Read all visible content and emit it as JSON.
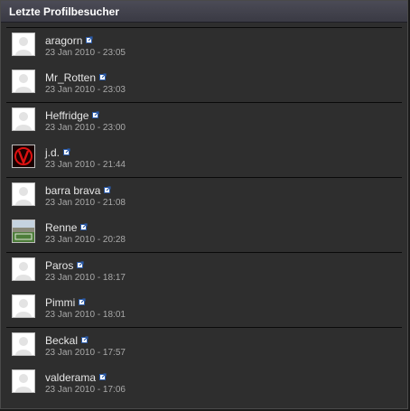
{
  "panel": {
    "title": "Letzte Profilbesucher"
  },
  "visitors": [
    {
      "name": "aragorn",
      "time": "23 Jan 2010 - 23:05",
      "avatar": "default-avatar"
    },
    {
      "name": "Mr_Rotten",
      "time": "23 Jan 2010 - 23:03",
      "avatar": "default-avatar"
    },
    {
      "name": "Heffridge",
      "time": "23 Jan 2010 - 23:00",
      "avatar": "default-avatar"
    },
    {
      "name": "j.d.",
      "time": "23 Jan 2010 - 21:44",
      "avatar": "red-v-logo"
    },
    {
      "name": "barra brava",
      "time": "23 Jan 2010 - 21:08",
      "avatar": "default-avatar"
    },
    {
      "name": "Renne",
      "time": "23 Jan 2010 - 20:28",
      "avatar": "stadium-photo"
    },
    {
      "name": "Paros",
      "time": "23 Jan 2010 - 18:17",
      "avatar": "default-avatar"
    },
    {
      "name": "Pimmi",
      "time": "23 Jan 2010 - 18:01",
      "avatar": "default-avatar"
    },
    {
      "name": "Beckal",
      "time": "23 Jan 2010 - 17:57",
      "avatar": "default-avatar"
    },
    {
      "name": "valderama",
      "time": "23 Jan 2010 - 17:06",
      "avatar": "default-avatar"
    }
  ]
}
